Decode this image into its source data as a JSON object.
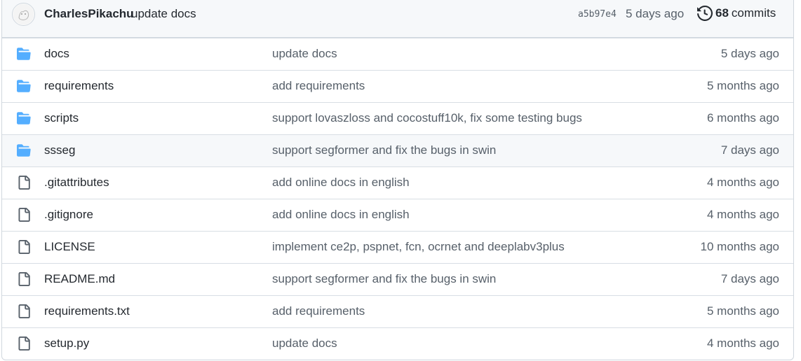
{
  "latest_commit": {
    "author": "CharlesPikachu",
    "message": "update docs",
    "sha": "a5b97e4",
    "time": "5 days ago",
    "commit_count": "68",
    "commit_label": "commits"
  },
  "files": [
    {
      "name": "docs",
      "type": "folder",
      "message": "update docs",
      "age": "5 days ago"
    },
    {
      "name": "requirements",
      "type": "folder",
      "message": "add requirements",
      "age": "5 months ago"
    },
    {
      "name": "scripts",
      "type": "folder",
      "message": "support lovaszloss and cocostuff10k, fix some testing bugs",
      "age": "6 months ago"
    },
    {
      "name": "ssseg",
      "type": "folder",
      "message": "support segformer and fix the bugs in swin",
      "age": "7 days ago"
    },
    {
      "name": ".gitattributes",
      "type": "file",
      "message": "add online docs in english",
      "age": "4 months ago"
    },
    {
      "name": ".gitignore",
      "type": "file",
      "message": "add online docs in english",
      "age": "4 months ago"
    },
    {
      "name": "LICENSE",
      "type": "file",
      "message": "implement ce2p, pspnet, fcn, ocrnet and deeplabv3plus",
      "age": "10 months ago"
    },
    {
      "name": "README.md",
      "type": "file",
      "message": "support segformer and fix the bugs in swin",
      "age": "7 days ago"
    },
    {
      "name": "requirements.txt",
      "type": "file",
      "message": "add requirements",
      "age": "5 months ago"
    },
    {
      "name": "setup.py",
      "type": "file",
      "message": "update docs",
      "age": "4 months ago"
    }
  ],
  "colors": {
    "folder": "#54aeff",
    "file_icon": "#57606a"
  }
}
